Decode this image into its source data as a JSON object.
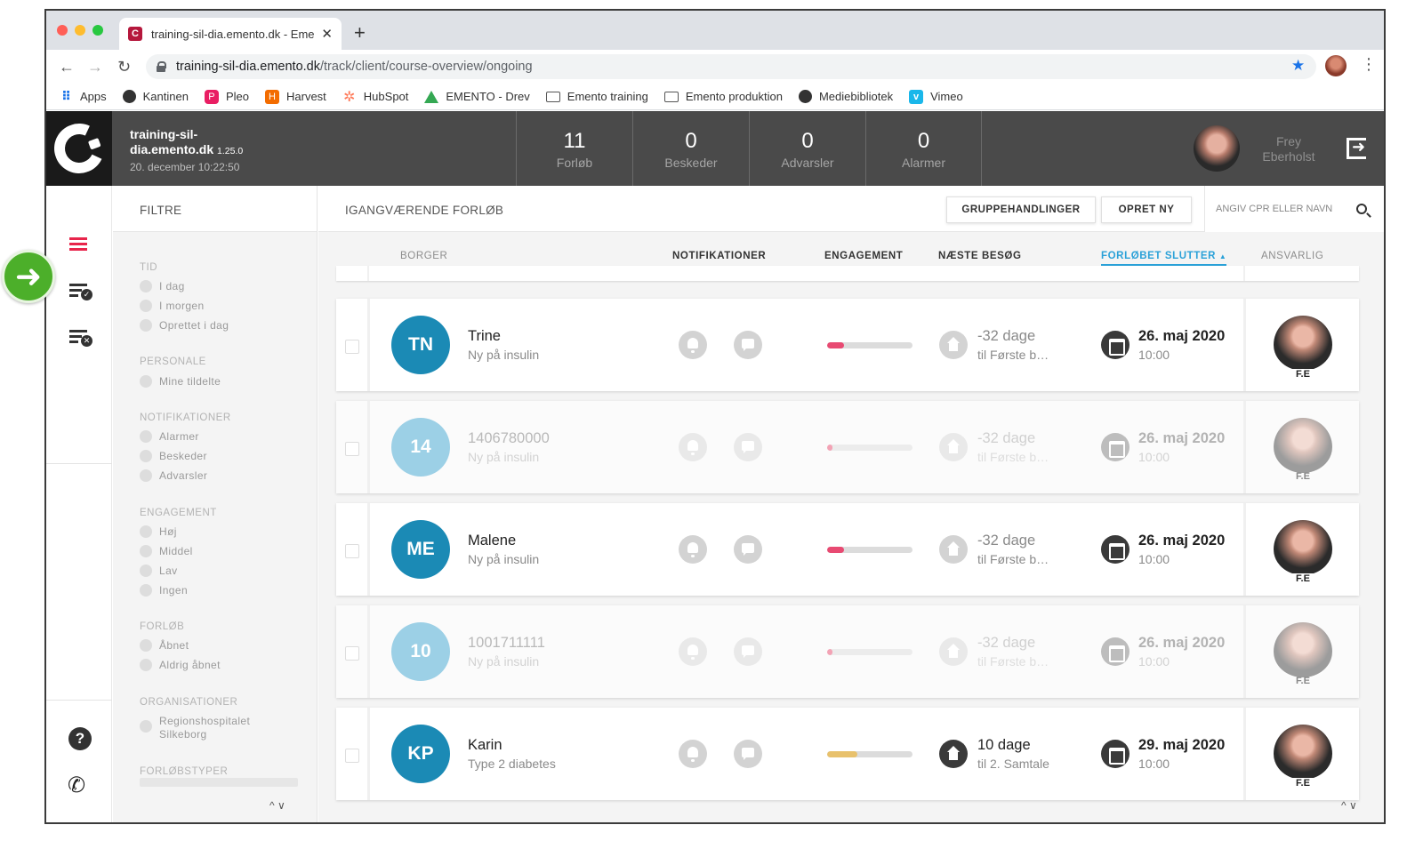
{
  "browser": {
    "tab_title": "training-sil-dia.emento.dk - Eme",
    "tab_close": "✕",
    "new_tab": "+",
    "url_host": "training-sil-dia.emento.dk",
    "url_path": "/track/client/course-overview/ongoing",
    "bookmarks": [
      {
        "label": "Apps",
        "icon": "apps-grid-icon"
      },
      {
        "label": "Kantinen",
        "icon": "globe-icon"
      },
      {
        "label": "Pleo",
        "icon": "pleo-icon"
      },
      {
        "label": "Harvest",
        "icon": "harvest-icon"
      },
      {
        "label": "HubSpot",
        "icon": "hubspot-icon"
      },
      {
        "label": "EMENTO - Drev",
        "icon": "google-drive-icon"
      },
      {
        "label": "Emento training",
        "icon": "folder-icon"
      },
      {
        "label": "Emento produktion",
        "icon": "folder-icon"
      },
      {
        "label": "Mediebibliotek",
        "icon": "globe-icon"
      },
      {
        "label": "Vimeo",
        "icon": "vimeo-icon"
      }
    ]
  },
  "header": {
    "site_name": "training-sil-dia.emento.dk",
    "version": "1.25.0",
    "datetime": "20. december 10:22:50",
    "stats": [
      {
        "value": "11",
        "label": "Forløb"
      },
      {
        "value": "0",
        "label": "Beskeder"
      },
      {
        "value": "0",
        "label": "Advarsler"
      },
      {
        "value": "0",
        "label": "Alarmer"
      }
    ],
    "user_name": "Frey Eberholst"
  },
  "filters": {
    "title": "FILTRE",
    "groups": [
      {
        "label": "TID",
        "options": [
          "I dag",
          "I morgen",
          "Oprettet i dag"
        ]
      },
      {
        "label": "PERSONALE",
        "options": [
          "Mine tildelte"
        ]
      },
      {
        "label": "NOTIFIKATIONER",
        "options": [
          "Alarmer",
          "Beskeder",
          "Advarsler"
        ]
      },
      {
        "label": "ENGAGEMENT",
        "options": [
          "Høj",
          "Middel",
          "Lav",
          "Ingen"
        ]
      },
      {
        "label": "FORLØB",
        "options": [
          "Åbnet",
          "Aldrig åbnet"
        ]
      },
      {
        "label": "ORGANISATIONER",
        "options": [
          "Regionshospitalet Silkeborg"
        ]
      },
      {
        "label": "FORLØBSTYPER",
        "options": []
      }
    ]
  },
  "main": {
    "title": "IGANGVÆRENDE FORLØB",
    "group_actions_label": "GRUPPEHANDLINGER",
    "create_label": "OPRET NY",
    "search_placeholder": "ANGIV CPR ELLER NAVN",
    "columns": {
      "citizen": "BORGER",
      "notifications": "NOTIFIKATIONER",
      "engagement": "ENGAGEMENT",
      "next_visit": "NÆSTE BESØG",
      "course_end": "FORLØBET SLUTTER",
      "responsible": "ANSVARLIG"
    },
    "sort_indicator": "▲",
    "rows": [
      {
        "initials": "TN",
        "name": "Trine",
        "desc": "Ny på insulin",
        "engagement_pct": 20,
        "engagement_color": "#e84a72",
        "visit": "-32 dage",
        "visit_sub": "til Første b…",
        "end_date": "26. maj 2020",
        "end_time": "10:00",
        "responsible": "F.E",
        "faded": false
      },
      {
        "initials": "14",
        "name": "1406780000",
        "desc": "Ny på insulin",
        "engagement_pct": 6,
        "engagement_color": "#f3a3b5",
        "visit": "-32 dage",
        "visit_sub": "til Første b…",
        "end_date": "26. maj 2020",
        "end_time": "10:00",
        "responsible": "F.E",
        "faded": true
      },
      {
        "initials": "ME",
        "name": "Malene",
        "desc": "Ny på insulin",
        "engagement_pct": 20,
        "engagement_color": "#e84a72",
        "visit": "-32 dage",
        "visit_sub": "til Første b…",
        "end_date": "26. maj 2020",
        "end_time": "10:00",
        "responsible": "F.E",
        "faded": false
      },
      {
        "initials": "10",
        "name": "1001711111",
        "desc": "Ny på insulin",
        "engagement_pct": 6,
        "engagement_color": "#f3a3b5",
        "visit": "-32 dage",
        "visit_sub": "til Første b…",
        "end_date": "26. maj 2020",
        "end_time": "10:00",
        "responsible": "F.E",
        "faded": true
      },
      {
        "initials": "KP",
        "name": "Karin",
        "desc": "Type 2 diabetes",
        "engagement_pct": 35,
        "engagement_color": "#e8c16c",
        "visit": "10 dage",
        "visit_sub": "til 2. Samtale",
        "end_date": "29. maj 2020",
        "end_time": "10:00",
        "responsible": "F.E",
        "faded": false
      }
    ]
  },
  "icons": {
    "rail": [
      "list-icon",
      "list-check-icon",
      "list-x-icon",
      "help-icon",
      "phone-queue-icon"
    ],
    "arrow": "➜",
    "chevrons": "^ ∨"
  }
}
